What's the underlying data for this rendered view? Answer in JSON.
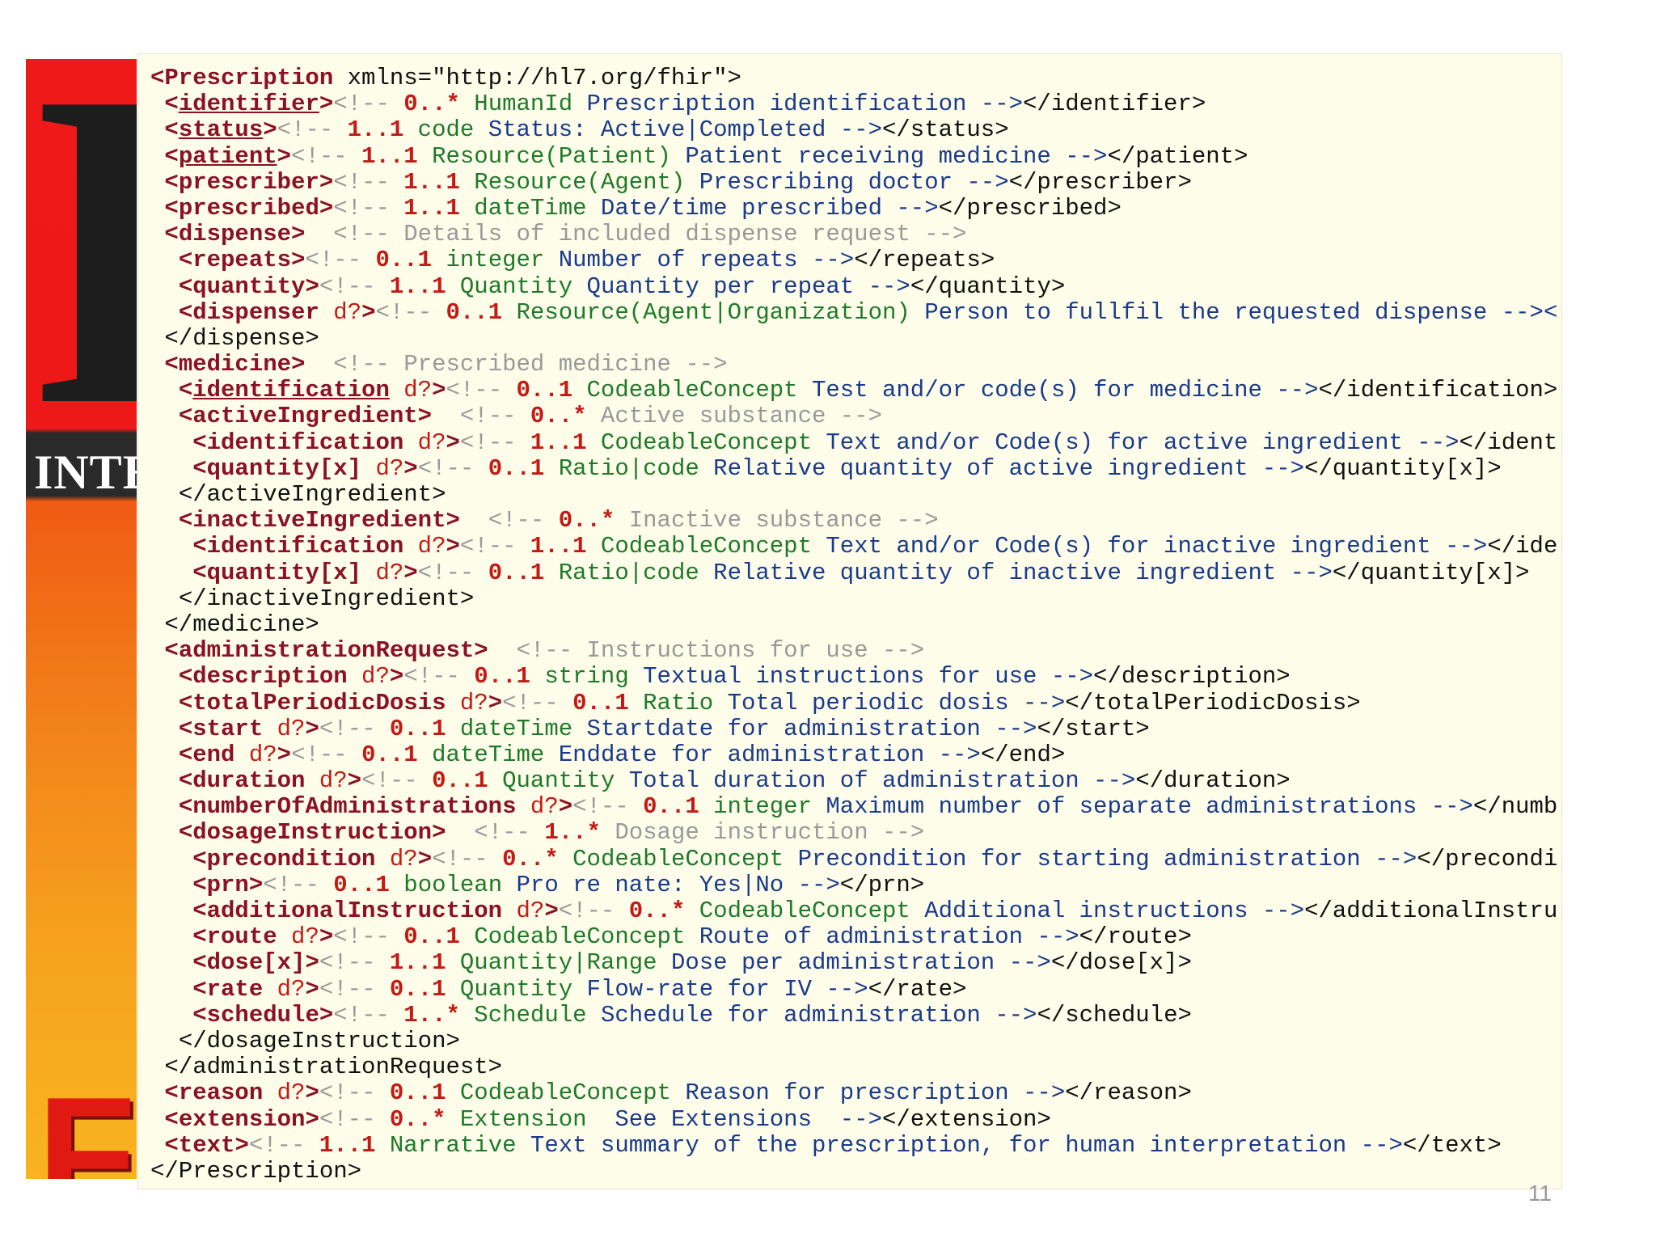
{
  "banner": {
    "letter": "H",
    "subtitle": "INTEI",
    "bottom_text": "FI"
  },
  "slide_number": "11",
  "lines": [
    {
      "indent": 0,
      "open": "<Prescription",
      "tag_name": "",
      "u": false,
      "optional": "",
      "close": "",
      "comment_prefix": "",
      "card": "",
      "type": "",
      "desc": "",
      "end": "",
      "plain": " xmlns=\"http://hl7.org/fhir\">"
    },
    {
      "indent": 1,
      "open": "<",
      "tag_name": "identifier",
      "u": true,
      "optional": "",
      "close": ">",
      "comment_prefix": "<!-- ",
      "card": "0..*",
      "type": " HumanId",
      "desc": " Prescription identification -->",
      "end": "</identifier>",
      "plain": ""
    },
    {
      "indent": 1,
      "open": "<",
      "tag_name": "status",
      "u": true,
      "optional": "",
      "close": ">",
      "comment_prefix": "<!-- ",
      "card": "1..1",
      "type": " code",
      "desc": " Status: Active|Completed -->",
      "end": "</status>",
      "plain": ""
    },
    {
      "indent": 1,
      "open": "<",
      "tag_name": "patient",
      "u": true,
      "optional": "",
      "close": ">",
      "comment_prefix": "<!-- ",
      "card": "1..1",
      "type": " Resource(Patient)",
      "desc": " Patient receiving medicine -->",
      "end": "</patient>",
      "plain": ""
    },
    {
      "indent": 1,
      "open": "<",
      "tag_name": "prescriber",
      "u": false,
      "optional": "",
      "close": ">",
      "comment_prefix": "<!-- ",
      "card": "1..1",
      "type": " Resource(Agent)",
      "desc": " Prescribing doctor -->",
      "end": "</prescriber>",
      "plain": ""
    },
    {
      "indent": 1,
      "open": "<",
      "tag_name": "prescribed",
      "u": false,
      "optional": "",
      "close": ">",
      "comment_prefix": "<!-- ",
      "card": "1..1",
      "type": " dateTime",
      "desc": " Date/time prescribed -->",
      "end": "</prescribed>",
      "plain": ""
    },
    {
      "indent": 1,
      "open": "<",
      "tag_name": "dispense",
      "u": false,
      "optional": "",
      "close": ">",
      "comment_prefix": "  <!-- Details of included dispense request -->",
      "card": "",
      "type": "",
      "desc": "",
      "end": "",
      "plain": ""
    },
    {
      "indent": 2,
      "open": "<",
      "tag_name": "repeats",
      "u": false,
      "optional": "",
      "close": ">",
      "comment_prefix": "<!-- ",
      "card": "0..1",
      "type": " integer",
      "desc": " Number of repeats -->",
      "end": "</repeats>",
      "plain": ""
    },
    {
      "indent": 2,
      "open": "<",
      "tag_name": "quantity",
      "u": false,
      "optional": "",
      "close": ">",
      "comment_prefix": "<!-- ",
      "card": "1..1",
      "type": " Quantity",
      "desc": " Quantity per repeat -->",
      "end": "</quantity>",
      "plain": ""
    },
    {
      "indent": 2,
      "open": "<",
      "tag_name": "dispenser",
      "u": false,
      "optional": " d?",
      "close": ">",
      "comment_prefix": "<!-- ",
      "card": "0..1",
      "type": " Resource(Agent|Organization)",
      "desc": " Person to fullfil the requested dispense --><",
      "end": "",
      "plain": ""
    },
    {
      "indent": 1,
      "open": "",
      "tag_name": "",
      "u": false,
      "optional": "",
      "close": "",
      "comment_prefix": "",
      "card": "",
      "type": "",
      "desc": "",
      "end": "",
      "plain": "</dispense>"
    },
    {
      "indent": 1,
      "open": "<",
      "tag_name": "medicine",
      "u": false,
      "optional": "",
      "close": ">",
      "comment_prefix": "  <!-- Prescribed medicine -->",
      "card": "",
      "type": "",
      "desc": "",
      "end": "",
      "plain": ""
    },
    {
      "indent": 2,
      "open": "<",
      "tag_name": "identification",
      "u": true,
      "optional": " d?",
      "close": ">",
      "comment_prefix": "<!-- ",
      "card": "0..1",
      "type": " CodeableConcept",
      "desc": " Test and/or code(s) for medicine -->",
      "end": "</identification>",
      "plain": ""
    },
    {
      "indent": 2,
      "open": "<",
      "tag_name": "activeIngredient",
      "u": false,
      "optional": "",
      "close": ">",
      "comment_prefix": "  <!-- ",
      "card": "0..*",
      "type": "",
      "desc": "",
      "end": "",
      "plain": "",
      "tail_comment": " Active substance -->"
    },
    {
      "indent": 3,
      "open": "<",
      "tag_name": "identification",
      "u": false,
      "optional": " d?",
      "close": ">",
      "comment_prefix": "<!-- ",
      "card": "1..1",
      "type": " CodeableConcept",
      "desc": " Text and/or Code(s) for active ingredient -->",
      "end": "</ident",
      "plain": ""
    },
    {
      "indent": 3,
      "open": "<",
      "tag_name": "quantity[x]",
      "u": false,
      "optional": " d?",
      "close": ">",
      "comment_prefix": "<!-- ",
      "card": "0..1",
      "type": " Ratio|code",
      "desc": " Relative quantity of active ingredient -->",
      "end": "</quantity[x]>",
      "plain": ""
    },
    {
      "indent": 2,
      "open": "",
      "tag_name": "",
      "u": false,
      "optional": "",
      "close": "",
      "comment_prefix": "",
      "card": "",
      "type": "",
      "desc": "",
      "end": "",
      "plain": "</activeIngredient>"
    },
    {
      "indent": 2,
      "open": "<",
      "tag_name": "inactiveIngredient",
      "u": false,
      "optional": "",
      "close": ">",
      "comment_prefix": "  <!-- ",
      "card": "0..*",
      "type": "",
      "desc": "",
      "end": "",
      "plain": "",
      "tail_comment": " Inactive substance -->"
    },
    {
      "indent": 3,
      "open": "<",
      "tag_name": "identification",
      "u": false,
      "optional": " d?",
      "close": ">",
      "comment_prefix": "<!-- ",
      "card": "1..1",
      "type": " CodeableConcept",
      "desc": " Text and/or Code(s) for inactive ingredient -->",
      "end": "</ide",
      "plain": ""
    },
    {
      "indent": 3,
      "open": "<",
      "tag_name": "quantity[x]",
      "u": false,
      "optional": " d?",
      "close": ">",
      "comment_prefix": "<!-- ",
      "card": "0..1",
      "type": " Ratio|code",
      "desc": " Relative quantity of inactive ingredient -->",
      "end": "</quantity[x]>",
      "plain": ""
    },
    {
      "indent": 2,
      "open": "",
      "tag_name": "",
      "u": false,
      "optional": "",
      "close": "",
      "comment_prefix": "",
      "card": "",
      "type": "",
      "desc": "",
      "end": "",
      "plain": "</inactiveIngredient>"
    },
    {
      "indent": 1,
      "open": "",
      "tag_name": "",
      "u": false,
      "optional": "",
      "close": "",
      "comment_prefix": "",
      "card": "",
      "type": "",
      "desc": "",
      "end": "",
      "plain": "</medicine>"
    },
    {
      "indent": 1,
      "open": "<",
      "tag_name": "administrationRequest",
      "u": false,
      "optional": "",
      "close": ">",
      "comment_prefix": "  <!-- Instructions for use -->",
      "card": "",
      "type": "",
      "desc": "",
      "end": "",
      "plain": ""
    },
    {
      "indent": 2,
      "open": "<",
      "tag_name": "description",
      "u": false,
      "optional": " d?",
      "close": ">",
      "comment_prefix": "<!-- ",
      "card": "0..1",
      "type": " string",
      "desc": " Textual instructions for use -->",
      "end": "</description>",
      "plain": ""
    },
    {
      "indent": 2,
      "open": "<",
      "tag_name": "totalPeriodicDosis",
      "u": false,
      "optional": " d?",
      "close": ">",
      "comment_prefix": "<!-- ",
      "card": "0..1",
      "type": " Ratio",
      "desc": " Total periodic dosis -->",
      "end": "</totalPeriodicDosis>",
      "plain": ""
    },
    {
      "indent": 2,
      "open": "<",
      "tag_name": "start",
      "u": false,
      "optional": " d?",
      "close": ">",
      "comment_prefix": "<!-- ",
      "card": "0..1",
      "type": " dateTime",
      "desc": " Startdate for administration -->",
      "end": "</start>",
      "plain": ""
    },
    {
      "indent": 2,
      "open": "<",
      "tag_name": "end",
      "u": false,
      "optional": " d?",
      "close": ">",
      "comment_prefix": "<!-- ",
      "card": "0..1",
      "type": " dateTime",
      "desc": " Enddate for administration -->",
      "end": "</end>",
      "plain": ""
    },
    {
      "indent": 2,
      "open": "<",
      "tag_name": "duration",
      "u": false,
      "optional": " d?",
      "close": ">",
      "comment_prefix": "<!-- ",
      "card": "0..1",
      "type": " Quantity",
      "desc": " Total duration of administration -->",
      "end": "</duration>",
      "plain": ""
    },
    {
      "indent": 2,
      "open": "<",
      "tag_name": "numberOfAdministrations",
      "u": false,
      "optional": " d?",
      "close": ">",
      "comment_prefix": "<!-- ",
      "card": "0..1",
      "type": " integer",
      "desc": " Maximum number of separate administrations -->",
      "end": "</numb",
      "plain": ""
    },
    {
      "indent": 2,
      "open": "<",
      "tag_name": "dosageInstruction",
      "u": false,
      "optional": "",
      "close": ">",
      "comment_prefix": "  <!-- ",
      "card": "1..*",
      "type": "",
      "desc": "",
      "end": "",
      "plain": "",
      "tail_comment": " Dosage instruction -->"
    },
    {
      "indent": 3,
      "open": "<",
      "tag_name": "precondition",
      "u": false,
      "optional": " d?",
      "close": ">",
      "comment_prefix": "<!-- ",
      "card": "0..*",
      "type": " CodeableConcept",
      "desc": " Precondition for starting administration -->",
      "end": "</precondi",
      "plain": ""
    },
    {
      "indent": 3,
      "open": "<",
      "tag_name": "prn",
      "u": false,
      "optional": "",
      "close": ">",
      "comment_prefix": "<!-- ",
      "card": "0..1",
      "type": " boolean",
      "desc": " Pro re nate: Yes|No -->",
      "end": "</prn>",
      "plain": ""
    },
    {
      "indent": 3,
      "open": "<",
      "tag_name": "additionalInstruction",
      "u": false,
      "optional": " d?",
      "close": ">",
      "comment_prefix": "<!-- ",
      "card": "0..*",
      "type": " CodeableConcept",
      "desc": " Additional instructions -->",
      "end": "</additionalInstru",
      "plain": ""
    },
    {
      "indent": 3,
      "open": "<",
      "tag_name": "route",
      "u": false,
      "optional": " d?",
      "close": ">",
      "comment_prefix": "<!-- ",
      "card": "0..1",
      "type": " CodeableConcept",
      "desc": " Route of administration -->",
      "end": "</route>",
      "plain": ""
    },
    {
      "indent": 3,
      "open": "<",
      "tag_name": "dose[x]",
      "u": false,
      "optional": "",
      "close": ">",
      "comment_prefix": "<!-- ",
      "card": "1..1",
      "type": " Quantity|Range",
      "desc": " Dose per administration -->",
      "end": "</dose[x]>",
      "plain": ""
    },
    {
      "indent": 3,
      "open": "<",
      "tag_name": "rate",
      "u": false,
      "optional": " d?",
      "close": ">",
      "comment_prefix": "<!-- ",
      "card": "0..1",
      "type": " Quantity",
      "desc": " Flow-rate for IV -->",
      "end": "</rate>",
      "plain": ""
    },
    {
      "indent": 3,
      "open": "<",
      "tag_name": "schedule",
      "u": false,
      "optional": "",
      "close": ">",
      "comment_prefix": "<!-- ",
      "card": "1..*",
      "type": " Schedule",
      "desc": " Schedule for administration -->",
      "end": "</schedule>",
      "plain": ""
    },
    {
      "indent": 2,
      "open": "",
      "tag_name": "",
      "u": false,
      "optional": "",
      "close": "",
      "comment_prefix": "",
      "card": "",
      "type": "",
      "desc": "",
      "end": "",
      "plain": "</dosageInstruction>"
    },
    {
      "indent": 1,
      "open": "",
      "tag_name": "",
      "u": false,
      "optional": "",
      "close": "",
      "comment_prefix": "",
      "card": "",
      "type": "",
      "desc": "",
      "end": "",
      "plain": "</administrationRequest>"
    },
    {
      "indent": 1,
      "open": "<",
      "tag_name": "reason",
      "u": false,
      "optional": " d?",
      "close": ">",
      "comment_prefix": "<!-- ",
      "card": "0..1",
      "type": " CodeableConcept",
      "desc": " Reason for prescription -->",
      "end": "</reason>",
      "plain": ""
    },
    {
      "indent": 1,
      "open": "<",
      "tag_name": "extension",
      "u": false,
      "optional": "",
      "close": ">",
      "comment_prefix": "<!-- ",
      "card": "0..*",
      "type": " Extension",
      "desc": "  See Extensions  -->",
      "end": "</extension>",
      "plain": ""
    },
    {
      "indent": 1,
      "open": "<",
      "tag_name": "text",
      "u": false,
      "optional": "",
      "close": ">",
      "comment_prefix": "<!-- ",
      "card": "1..1",
      "type": " Narrative",
      "desc": " Text summary of the prescription, for human interpretation -->",
      "end": "</text>",
      "plain": ""
    },
    {
      "indent": 0,
      "open": "",
      "tag_name": "",
      "u": false,
      "optional": "",
      "close": "",
      "comment_prefix": "",
      "card": "",
      "type": "",
      "desc": "",
      "end": "",
      "plain": "</Prescription>"
    }
  ]
}
